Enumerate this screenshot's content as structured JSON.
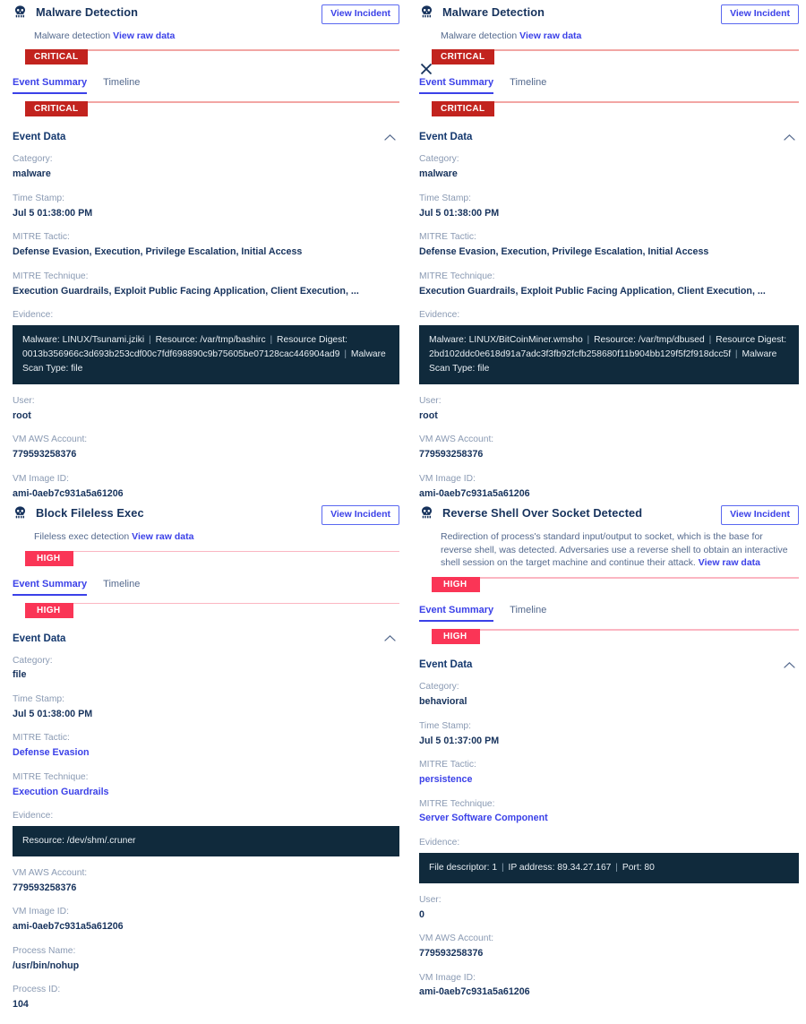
{
  "left_pane": {
    "cards": [
      {
        "icon": "skull-icon",
        "title": "Malware Detection",
        "view_incident_label": "View Incident",
        "description": "Malware detection",
        "raw_data_link": "View raw data",
        "severity": "CRITICAL",
        "severity_level": "critical",
        "tabs": [
          {
            "label": "Event Summary",
            "active": true
          },
          {
            "label": "Timeline",
            "active": false
          }
        ],
        "section_title": "Event Data",
        "fields": [
          {
            "label": "Category:",
            "value": "malware",
            "link": false
          },
          {
            "label": "Time Stamp:",
            "value": "Jul 5 01:38:00 PM",
            "link": false
          },
          {
            "label": "MITRE Tactic:",
            "value": "Defense Evasion, Execution, Privilege Escalation, Initial Access",
            "link": false
          },
          {
            "label": "MITRE Technique:",
            "value": "Execution Guardrails, Exploit Public Facing Application, Client Execution, ...",
            "link": false
          }
        ],
        "evidence_label": "Evidence:",
        "evidence": "Malware: LINUX/Tsunami.jziki | Resource: /var/tmp/bashirc | Resource Digest: 0013b356966c3d693b253cdf00c7fdf698890c9b75605be07128cac446904ad9 | Malware Scan Type: file",
        "fields_after": [
          {
            "label": "User:",
            "value": "root",
            "link": false
          },
          {
            "label": "VM AWS Account:",
            "value": "779593258376",
            "link": false
          },
          {
            "label": "VM Image ID:",
            "value": "ami-0aeb7c931a5a61206",
            "link": false
          }
        ]
      },
      {
        "icon": "skull-icon",
        "title": "Block Fileless Exec",
        "view_incident_label": "View Incident",
        "description": "Fileless exec detection",
        "raw_data_link": "View raw data",
        "severity": "HIGH",
        "severity_level": "high",
        "tabs": [
          {
            "label": "Event Summary",
            "active": true
          },
          {
            "label": "Timeline",
            "active": false
          }
        ],
        "section_title": "Event Data",
        "fields": [
          {
            "label": "Category:",
            "value": "file",
            "link": false
          },
          {
            "label": "Time Stamp:",
            "value": "Jul 5 01:38:00 PM",
            "link": false
          },
          {
            "label": "MITRE Tactic:",
            "value": "Defense Evasion",
            "link": true
          },
          {
            "label": "MITRE Technique:",
            "value": "Execution Guardrails",
            "link": true
          }
        ],
        "evidence_label": "Evidence:",
        "evidence": "Resource: /dev/shm/.cruner",
        "fields_after": [
          {
            "label": "VM AWS Account:",
            "value": "779593258376",
            "link": false
          },
          {
            "label": "VM Image ID:",
            "value": "ami-0aeb7c931a5a61206",
            "link": false
          },
          {
            "label": "Process Name:",
            "value": "/usr/bin/nohup",
            "link": false
          },
          {
            "label": "Process ID:",
            "value": "104",
            "link": false
          }
        ]
      }
    ]
  },
  "right_pane": {
    "close_icon": "close-icon",
    "cards": [
      {
        "icon": "skull-icon",
        "title": "Malware Detection",
        "view_incident_label": "View Incident",
        "description": "Malware detection",
        "raw_data_link": "View raw data",
        "severity": "CRITICAL",
        "severity_level": "critical",
        "tabs": [
          {
            "label": "Event Summary",
            "active": true
          },
          {
            "label": "Timeline",
            "active": false
          }
        ],
        "section_title": "Event Data",
        "fields": [
          {
            "label": "Category:",
            "value": "malware",
            "link": false
          },
          {
            "label": "Time Stamp:",
            "value": "Jul 5 01:38:00 PM",
            "link": false
          },
          {
            "label": "MITRE Tactic:",
            "value": "Defense Evasion, Execution, Privilege Escalation, Initial Access",
            "link": false
          },
          {
            "label": "MITRE Technique:",
            "value": "Execution Guardrails, Exploit Public Facing Application, Client Execution, ...",
            "link": false
          }
        ],
        "evidence_label": "Evidence:",
        "evidence": "Malware: LINUX/BitCoinMiner.wmsho | Resource: /var/tmp/dbused | Resource Digest: 2bd102ddc0e618d91a7adc3f3fb92fcfb258680f11b904bb129f5f2f918dcc5f | Malware Scan Type: file",
        "fields_after": [
          {
            "label": "User:",
            "value": "root",
            "link": false
          },
          {
            "label": "VM AWS Account:",
            "value": "779593258376",
            "link": false
          },
          {
            "label": "VM Image ID:",
            "value": "ami-0aeb7c931a5a61206",
            "link": false
          }
        ]
      },
      {
        "icon": "skull-icon",
        "title": "Reverse Shell Over Socket Detected",
        "view_incident_label": "View Incident",
        "description": "Redirection of process's standard input/output to socket, which is the base for reverse shell, was detected. Adversaries use a reverse shell to obtain an interactive shell session on the target machine and continue their attack.",
        "raw_data_link": "View raw data",
        "severity": "HIGH",
        "severity_level": "high",
        "tabs": [
          {
            "label": "Event Summary",
            "active": true
          },
          {
            "label": "Timeline",
            "active": false
          }
        ],
        "section_title": "Event Data",
        "fields": [
          {
            "label": "Category:",
            "value": "behavioral",
            "link": false
          },
          {
            "label": "Time Stamp:",
            "value": "Jul 5 01:37:00 PM",
            "link": false
          },
          {
            "label": "MITRE Tactic:",
            "value": "persistence",
            "link": true
          },
          {
            "label": "MITRE Technique:",
            "value": "Server Software Component",
            "link": true
          }
        ],
        "evidence_label": "Evidence:",
        "evidence": "File descriptor: 1 | IP address: 89.34.27.167 | Port: 80",
        "fields_after": [
          {
            "label": "User:",
            "value": "0",
            "link": false
          },
          {
            "label": "VM AWS Account:",
            "value": "779593258376",
            "link": false
          },
          {
            "label": "VM Image ID:",
            "value": "ami-0aeb7c931a5a61206",
            "link": false
          }
        ]
      }
    ]
  },
  "colors": {
    "critical": "#c2231e",
    "high": "#fa3556",
    "link": "#3b41e8",
    "evidence_bg": "#102a3c",
    "label": "#8a9ab3",
    "value": "#16325c"
  }
}
